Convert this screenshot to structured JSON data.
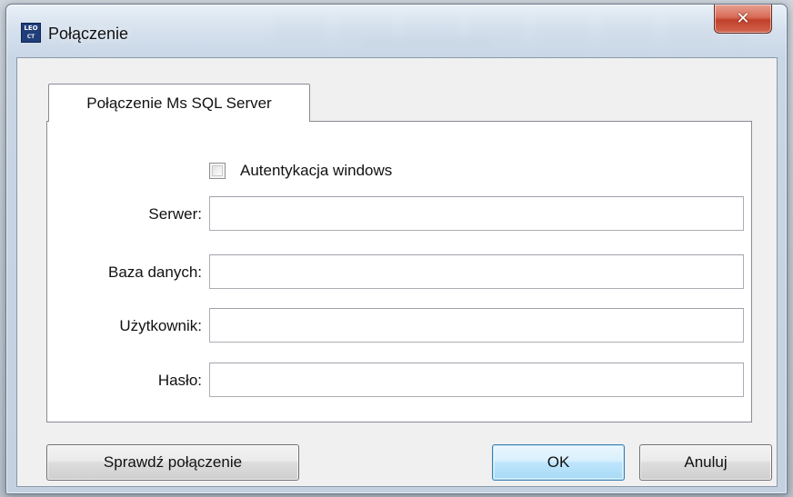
{
  "window": {
    "title": "Połączenie",
    "icon_text_top": "LEO",
    "icon_text_bottom": "CT",
    "close_glyph": "✕"
  },
  "tab": {
    "label": "Połączenie Ms SQL Server"
  },
  "auth": {
    "checkbox_label": "Autentykacja windows",
    "checked": false
  },
  "fields": {
    "server_label": "Serwer:",
    "server_value": "",
    "database_label": "Baza danych:",
    "database_value": "",
    "user_label": "Użytkownik:",
    "user_value": "",
    "password_label": "Hasło:",
    "password_value": ""
  },
  "buttons": {
    "test_connection": "Sprawdź połączenie",
    "ok": "OK",
    "cancel": "Anuluj"
  },
  "colors": {
    "close_button": "#c0402a",
    "default_button_border": "#3c7fb1",
    "app_icon_bg": "#1f3d7a"
  },
  "icons": {
    "app": "leoct-app-icon",
    "close": "close-icon"
  }
}
